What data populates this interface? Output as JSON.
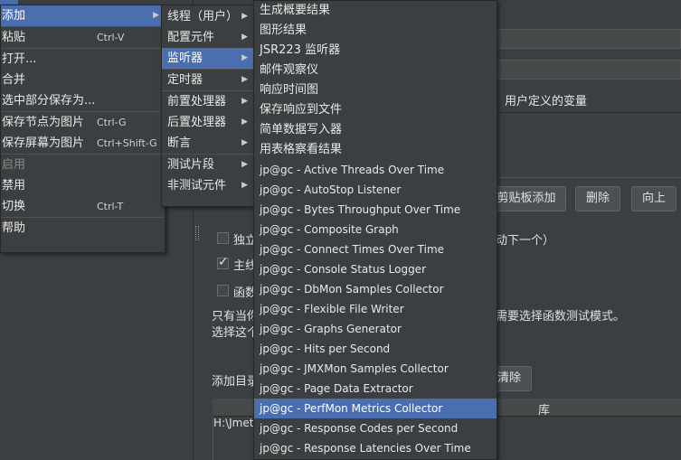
{
  "background": {
    "user_defined_vars_header": "用户定义的变量",
    "buttons": {
      "clipboard_add": "剪贴板添加",
      "delete": "删除",
      "up": "向上",
      "clear": "清除"
    },
    "checkbox_labels": [
      "独立",
      "主线",
      "函数"
    ],
    "next_hint": "动下一个）",
    "func_note_1": "只有当你",
    "func_note_2": "需要选择函数测试模式。",
    "select_text": "选择这个",
    "add_dir_label": "添加目录",
    "lib_header": "库",
    "lib_row_value": "H:\\Jmete"
  },
  "menu_level1": {
    "items": [
      {
        "label": "添加",
        "accel": "",
        "submenu": true,
        "selected": true,
        "disabled": false
      },
      {
        "separator": true
      },
      {
        "label": "粘贴",
        "accel": "Ctrl-V",
        "submenu": false,
        "selected": false,
        "disabled": false
      },
      {
        "separator": true
      },
      {
        "label": "打开...",
        "accel": "",
        "submenu": false,
        "selected": false,
        "disabled": false
      },
      {
        "label": "合并",
        "accel": "",
        "submenu": false,
        "selected": false,
        "disabled": false
      },
      {
        "label": "选中部分保存为...",
        "accel": "",
        "submenu": false,
        "selected": false,
        "disabled": false
      },
      {
        "separator": true
      },
      {
        "label": "保存节点为图片",
        "accel": "Ctrl-G",
        "submenu": false,
        "selected": false,
        "disabled": false
      },
      {
        "label": "保存屏幕为图片",
        "accel": "Ctrl+Shift-G",
        "submenu": false,
        "selected": false,
        "disabled": false
      },
      {
        "separator": true
      },
      {
        "label": "启用",
        "accel": "",
        "submenu": false,
        "selected": false,
        "disabled": true
      },
      {
        "label": "禁用",
        "accel": "",
        "submenu": false,
        "selected": false,
        "disabled": false
      },
      {
        "label": "切换",
        "accel": "Ctrl-T",
        "submenu": false,
        "selected": false,
        "disabled": false
      },
      {
        "separator": true
      },
      {
        "label": "帮助",
        "accel": "",
        "submenu": false,
        "selected": false,
        "disabled": false
      }
    ]
  },
  "menu_level2": {
    "items": [
      {
        "label": "线程（用户）",
        "selected": false
      },
      {
        "label": "配置元件",
        "selected": false
      },
      {
        "label": "监听器",
        "selected": true
      },
      {
        "separator": true
      },
      {
        "label": "定时器",
        "selected": false
      },
      {
        "separator": true
      },
      {
        "label": "前置处理器",
        "selected": false
      },
      {
        "label": "后置处理器",
        "selected": false
      },
      {
        "label": "断言",
        "selected": false
      },
      {
        "separator": true
      },
      {
        "label": "测试片段",
        "selected": false
      },
      {
        "label": "非测试元件",
        "selected": false
      }
    ]
  },
  "menu_level3": {
    "items": [
      {
        "label": "生成概要结果",
        "selected": false
      },
      {
        "label": "图形结果",
        "selected": false
      },
      {
        "label": "JSR223 监听器",
        "selected": false
      },
      {
        "label": "邮件观察仪",
        "selected": false
      },
      {
        "label": "响应时间图",
        "selected": false
      },
      {
        "label": "保存响应到文件",
        "selected": false
      },
      {
        "label": "简单数据写入器",
        "selected": false
      },
      {
        "label": "用表格察看结果",
        "selected": false
      },
      {
        "label": "jp@gc - Active Threads Over Time",
        "selected": false
      },
      {
        "label": "jp@gc - AutoStop Listener",
        "selected": false
      },
      {
        "label": "jp@gc - Bytes Throughput Over Time",
        "selected": false
      },
      {
        "label": "jp@gc - Composite Graph",
        "selected": false
      },
      {
        "label": "jp@gc - Connect Times Over Time",
        "selected": false
      },
      {
        "label": "jp@gc - Console Status Logger",
        "selected": false
      },
      {
        "label": "jp@gc - DbMon Samples Collector",
        "selected": false
      },
      {
        "label": "jp@gc - Flexible File Writer",
        "selected": false
      },
      {
        "label": "jp@gc - Graphs Generator",
        "selected": false
      },
      {
        "label": "jp@gc - Hits per Second",
        "selected": false
      },
      {
        "label": "jp@gc - JMXMon Samples Collector",
        "selected": false
      },
      {
        "label": "jp@gc - Page Data Extractor",
        "selected": false
      },
      {
        "label": "jp@gc - PerfMon Metrics Collector",
        "selected": true
      },
      {
        "label": "jp@gc - Response Codes per Second",
        "selected": false
      },
      {
        "label": "jp@gc - Response Latencies Over Time",
        "selected": false
      }
    ]
  },
  "colors": {
    "selection": "#4b6eaf",
    "menu_bg": "#3c3f41",
    "text": "#e8e8e8",
    "disabled_text": "#8a8a8a"
  }
}
